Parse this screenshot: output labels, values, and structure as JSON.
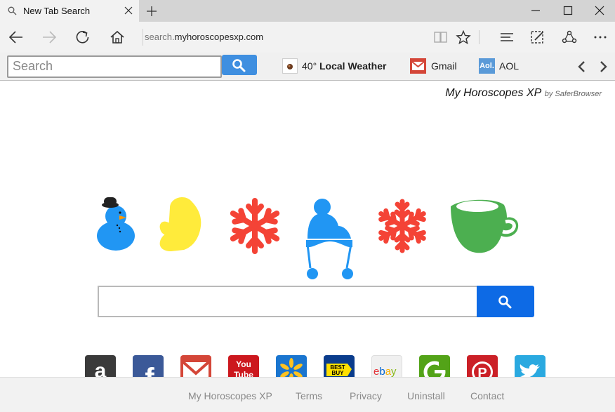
{
  "tab": {
    "title": "New Tab Search",
    "new_tab": "+"
  },
  "address": {
    "prefix": "search.",
    "domain": "myhoroscopesxp.com"
  },
  "toolbar": {
    "search_placeholder": "Search",
    "weather_temp": "40°",
    "weather_label": "Local Weather",
    "links": [
      {
        "label": "Gmail"
      },
      {
        "label": "AOL"
      }
    ],
    "aol_logo": "Aol."
  },
  "brand": {
    "name": "My Horoscopes XP",
    "by": "by SaferBrowser"
  },
  "decorations": [
    "snowman-icon",
    "mitten-icon",
    "snowflake-icon",
    "winter-hat-icon",
    "snowflake-icon",
    "mug-icon"
  ],
  "tiles": [
    {
      "name": "amazon",
      "text": "a",
      "color": "#3a3a3a"
    },
    {
      "name": "facebook",
      "text": "f",
      "color": "#3b5998"
    },
    {
      "name": "gmail",
      "text": "",
      "color": "#d44638"
    },
    {
      "name": "youtube",
      "text": "You Tube",
      "color": "#cc181e"
    },
    {
      "name": "walmart",
      "text": "",
      "color": "#1a75cf"
    },
    {
      "name": "bestbuy",
      "text": "BEST BUY",
      "color": "#0a3c8c"
    },
    {
      "name": "ebay",
      "text": "ebay",
      "color": "#f0f0f0"
    },
    {
      "name": "groupon",
      "text": "G",
      "color": "#53a318"
    },
    {
      "name": "pinterest",
      "text": "P",
      "color": "#cb2027"
    },
    {
      "name": "twitter",
      "text": "",
      "color": "#2aa9e0"
    }
  ],
  "footer": [
    "My Horoscopes XP",
    "Terms",
    "Privacy",
    "Uninstall",
    "Contact"
  ],
  "colors": {
    "accent": "#0d6ae5",
    "toolbar_button": "#3f8fe0",
    "deco_blue": "#2196f3",
    "deco_red": "#f44336",
    "deco_yellow": "#ffeb3b",
    "deco_green": "#4caf50"
  }
}
